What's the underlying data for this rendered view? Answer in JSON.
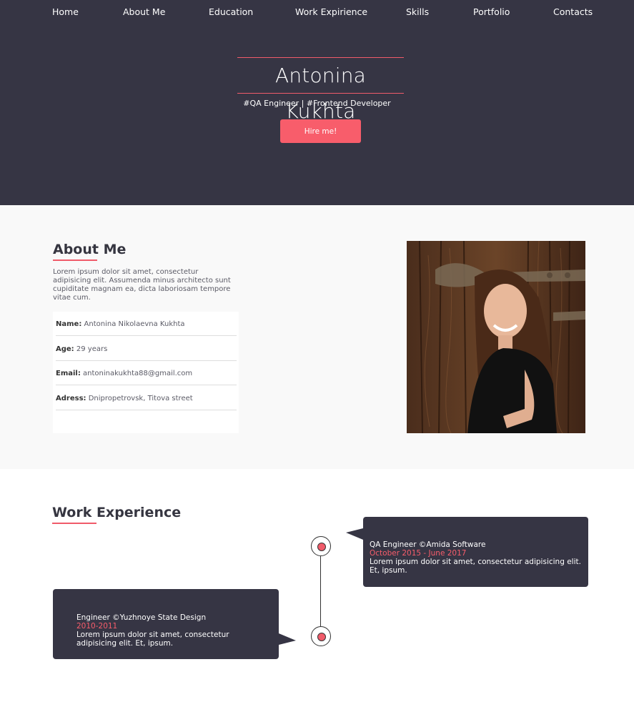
{
  "nav": {
    "items": [
      "Home",
      "About Me",
      "Education",
      "Work Expirience",
      "Skills",
      "Portfolio",
      "Contacts"
    ]
  },
  "hero": {
    "name": "Antonina Kukhta",
    "subtitle": "#QA Engineer | #Frontend Developer",
    "hire_label": "Hire me!"
  },
  "about": {
    "heading": "About Me",
    "text": "Lorem ipsum dolor sit amet, consectetur adipisicing elit. Assumenda minus architecto sunt cupiditate magnam ea, dicta laboriosam tempore vitae cum.",
    "info": [
      {
        "label": "Name:",
        "value": "Antonina Nikolaevna Kukhta"
      },
      {
        "label": "Age:",
        "value": "29 years"
      },
      {
        "label": "Email:",
        "value": "antoninakukhta88@gmail.com"
      },
      {
        "label": "Adress:",
        "value": "Dnipropetrovsk, Titova street"
      }
    ]
  },
  "work": {
    "heading": "Work Experience",
    "entries": [
      {
        "title": "QA Engineer ©Amida Software",
        "dates": "October 2015 - June 2017",
        "text": "Lorem ipsum dolor sit amet, consectetur adipisicing elit. Et, ipsum."
      },
      {
        "title": "Engineer ©Yuzhnoye State Design",
        "dates": "2010-2011",
        "text": "Lorem ipsum dolor sit amet, consectetur adipisicing elit. Et, ipsum."
      }
    ]
  },
  "colors": {
    "dark": "#363544",
    "accent": "#f85d6b",
    "light_bg": "#f9f9f9"
  }
}
